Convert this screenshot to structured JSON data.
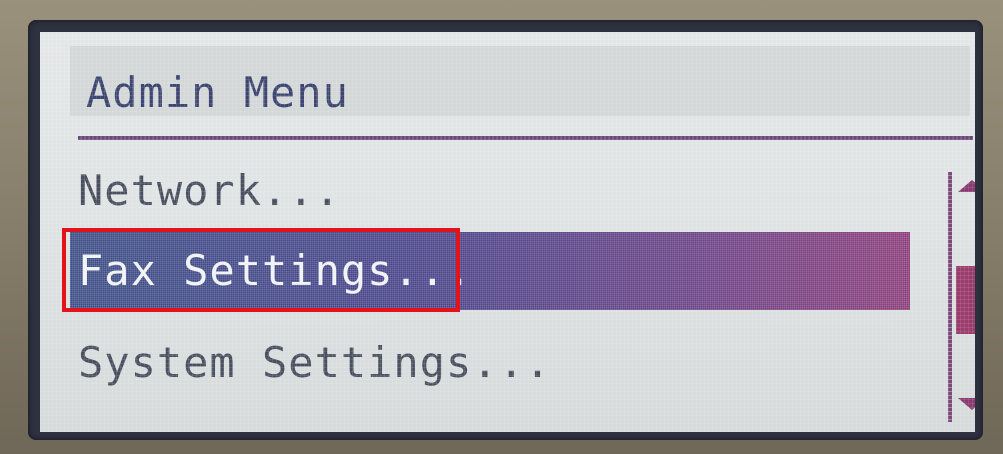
{
  "header": {
    "title": "Admin Menu"
  },
  "menu": {
    "items": [
      {
        "label": "Network..."
      },
      {
        "label": "Fax Settings..."
      },
      {
        "label": "System Settings..."
      }
    ],
    "selected_index": 1
  },
  "scrollbar": {
    "up_icon": "triangle-up-icon",
    "down_icon": "triangle-down-icon"
  },
  "annotation": {
    "highlight_color": "#e3121b"
  }
}
